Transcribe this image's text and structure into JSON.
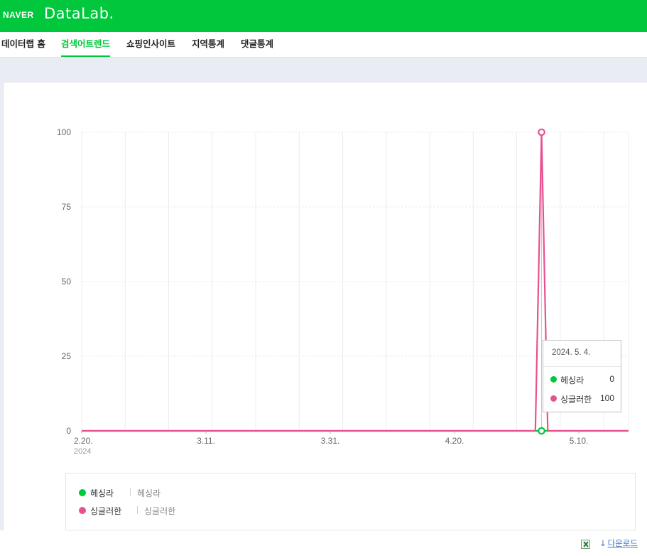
{
  "header": {
    "brand": "NAVER",
    "product": "DataLab."
  },
  "nav": {
    "items": [
      {
        "label": "데이터랩 홈",
        "active": false
      },
      {
        "label": "검색어트렌드",
        "active": true
      },
      {
        "label": "쇼핑인사이트",
        "active": false
      },
      {
        "label": "지역통계",
        "active": false
      },
      {
        "label": "댓글통계",
        "active": false
      }
    ]
  },
  "chart_data": {
    "type": "line",
    "y_ticks": [
      "0",
      "25",
      "50",
      "75",
      "100"
    ],
    "ylim": [
      0,
      100
    ],
    "x_ticks": [
      {
        "label": "2.20.",
        "sub": "2024"
      },
      {
        "label": "3.11.",
        "sub": ""
      },
      {
        "label": "3.31.",
        "sub": ""
      },
      {
        "label": "4.20.",
        "sub": ""
      },
      {
        "label": "5.10.",
        "sub": ""
      }
    ],
    "x_tick_dates": [
      "2024-02-20",
      "2024-03-11",
      "2024-03-31",
      "2024-04-20",
      "2024-05-10"
    ],
    "xlim": [
      "2024-02-20",
      "2024-05-18"
    ],
    "grid": true,
    "series": [
      {
        "name": "헤싱라",
        "color": "#00c73c",
        "points": [
          [
            "2024-02-20",
            0
          ],
          [
            "2024-05-18",
            0
          ]
        ],
        "marker": [
          "2024-05-04",
          0
        ]
      },
      {
        "name": "싱글러한",
        "color": "#e8518f",
        "points": [
          [
            "2024-02-20",
            0
          ],
          [
            "2024-05-03",
            0
          ],
          [
            "2024-05-04",
            100
          ],
          [
            "2024-05-05",
            0
          ],
          [
            "2024-05-18",
            0
          ]
        ],
        "marker": [
          "2024-05-04",
          100
        ]
      }
    ]
  },
  "tooltip": {
    "date": "2024. 5. 4.",
    "rows": [
      {
        "name": "헤싱라",
        "value": "0",
        "color": "#00c73c"
      },
      {
        "name": "싱글러한",
        "value": "100",
        "color": "#e8518f"
      }
    ]
  },
  "legend": {
    "items": [
      {
        "name": "헤싱라",
        "keywords": "헤싱라",
        "color": "#00c73c"
      },
      {
        "name": "싱글러한",
        "keywords": "싱글러한",
        "color": "#e8518f"
      }
    ]
  },
  "footer": {
    "download_label": "다운로드",
    "excel_icon": "excel-icon",
    "download_icon": "download-arrow-icon"
  }
}
